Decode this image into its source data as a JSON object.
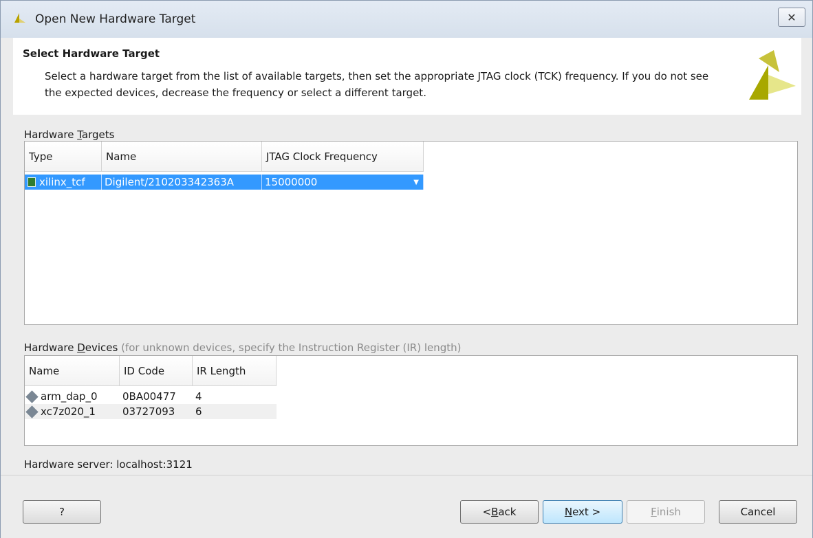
{
  "window": {
    "title": "Open New Hardware Target",
    "close_glyph": "✕"
  },
  "header": {
    "title": "Select Hardware Target",
    "description": "Select a hardware target from the list of available targets, then set the appropriate JTAG clock (TCK) frequency. If you do not see the expected devices, decrease the frequency or select a different target."
  },
  "targets": {
    "label_pre": "Hardware ",
    "label_u": "T",
    "label_post": "argets",
    "columns": [
      "Type",
      "Name",
      "JTAG Clock Frequency"
    ],
    "rows": [
      {
        "type": "xilinx_tcf",
        "name": "Digilent/210203342363A",
        "freq": "15000000",
        "selected": true,
        "icon": "board-icon"
      }
    ]
  },
  "devices": {
    "label_pre": "Hardware ",
    "label_u": "D",
    "label_post": "evices",
    "hint": " (for unknown devices, specify the Instruction Register (IR) length)",
    "columns": [
      "Name",
      "ID Code",
      "IR Length"
    ],
    "rows": [
      {
        "name": "arm_dap_0",
        "id_code": "0BA00477",
        "ir_length": "4",
        "icon": "chip-icon"
      },
      {
        "name": "xc7z020_1",
        "id_code": "03727093",
        "ir_length": "6",
        "icon": "chip-icon"
      }
    ]
  },
  "server": {
    "text": "Hardware server: localhost:3121"
  },
  "buttons": {
    "help": "?",
    "back_pre": "< ",
    "back_u": "B",
    "back_post": "ack",
    "next_u": "N",
    "next_post": "ext >",
    "finish_u": "F",
    "finish_post": "inish",
    "cancel": "Cancel"
  },
  "colors": {
    "selection": "#3399ff",
    "logo_dark": "#a8a800",
    "logo_light": "#e6e68a"
  }
}
